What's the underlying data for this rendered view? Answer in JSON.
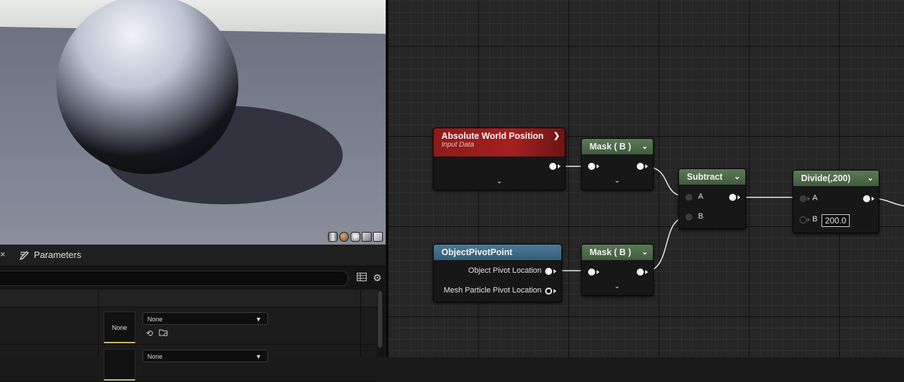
{
  "viewport": {
    "preview_modes": [
      "cylinder-preview",
      "sphere-preview",
      "plane-preview",
      "cube-preview",
      "custom-mesh-preview"
    ]
  },
  "panel": {
    "tab_close": "×",
    "tab_label": "Parameters",
    "rows": [
      {
        "thumb_label": "None",
        "combo_value": "None"
      },
      {
        "thumb_label": "",
        "combo_value": "None"
      }
    ]
  },
  "graph": {
    "nodes": {
      "abs_world_pos": {
        "title": "Absolute World Position",
        "subtitle": "Input Data"
      },
      "mask_b_top": {
        "title": "Mask ( B )"
      },
      "subtract": {
        "title": "Subtract",
        "pin_a": "A",
        "pin_b": "B"
      },
      "divide": {
        "title": "Divide(,200)",
        "pin_a": "A",
        "pin_b": "B",
        "value_b": "200.0"
      },
      "object_pivot": {
        "title": "ObjectPivotPoint",
        "pin_1": "Object Pivot Location",
        "pin_2": "Mesh Particle Pivot Location"
      },
      "mask_b_bottom": {
        "title": "Mask ( B )"
      }
    },
    "accent": {
      "input_node": "#a32020",
      "math_node": "#4f6d4a",
      "function_node": "#426c87"
    }
  }
}
